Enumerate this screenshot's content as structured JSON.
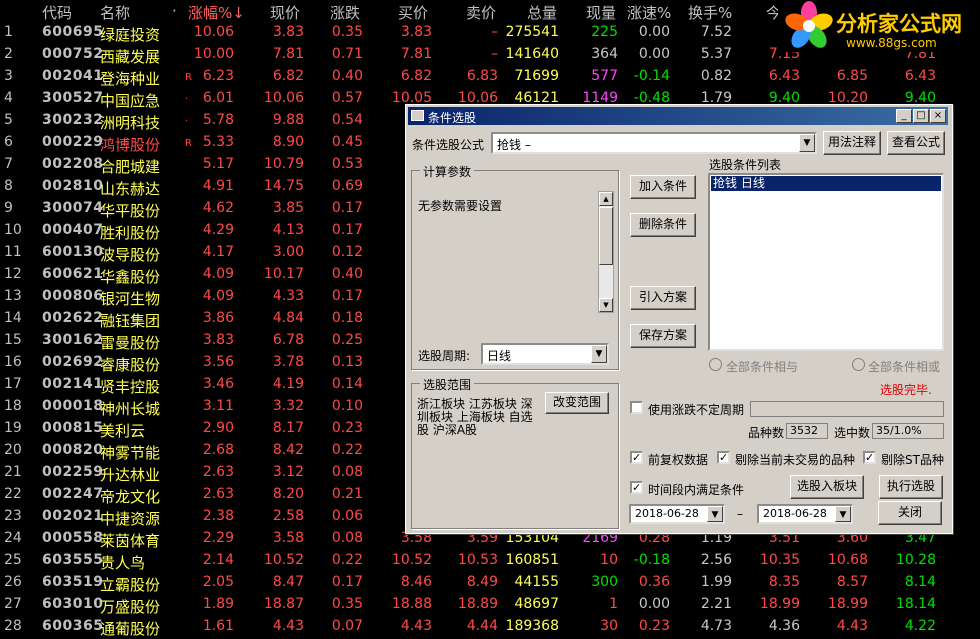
{
  "headers": [
    "代码",
    "名称",
    "·",
    "涨幅%↓",
    "现价",
    "涨跌",
    "买价",
    "卖价",
    "总量",
    "现量",
    "涨速%",
    "换手%",
    "今"
  ],
  "rows": [
    {
      "idx": "1",
      "code": "600695",
      "name": "绿庭投资",
      "flag": "",
      "pct": "10.06",
      "price": "3.83",
      "chg": "0.35",
      "bid": "3.83",
      "ask": "–",
      "vol": "275541",
      "cur": "225",
      "spd": "0.00",
      "turn": "7.52",
      "open": "3",
      "high": "",
      "low": "",
      "c4": ""
    },
    {
      "idx": "2",
      "code": "000752",
      "name": "西藏发展",
      "flag": "",
      "pct": "10.00",
      "price": "7.81",
      "chg": "0.71",
      "bid": "7.81",
      "ask": "–",
      "vol": "141640",
      "cur": "364",
      "spd": "0.00",
      "turn": "5.37",
      "open": "7.15",
      "high": "",
      "low": "",
      "c4": "7.81"
    },
    {
      "idx": "3",
      "code": "002041",
      "name": "登海种业",
      "flag": "R",
      "pct": "6.23",
      "price": "6.82",
      "chg": "0.40",
      "bid": "6.82",
      "ask": "6.83",
      "vol": "71699",
      "cur": "577",
      "spd": "-0.14",
      "turn": "0.82",
      "open": "6.43",
      "high": "6.85",
      "low": "",
      "c4": "6.43"
    },
    {
      "idx": "4",
      "code": "300527",
      "name": "中国应急",
      "flag": "·",
      "pct": "6.01",
      "price": "10.06",
      "chg": "0.57",
      "bid": "10.05",
      "ask": "10.06",
      "vol": "46121",
      "cur": "1149",
      "spd": "-0.48",
      "turn": "1.79",
      "open": "9.40",
      "high": "10.20",
      "low": "",
      "c4": "9.40"
    },
    {
      "idx": "5",
      "code": "300232",
      "name": "洲明科技",
      "flag": "·",
      "pct": "5.78",
      "price": "9.88",
      "chg": "0.54",
      "bid": "",
      "ask": "",
      "vol": "",
      "cur": "",
      "spd": "",
      "turn": "",
      "open": "",
      "high": "",
      "low": "",
      "c4": ""
    },
    {
      "idx": "6",
      "code": "000229",
      "name": "鸿博股份",
      "flag": "R",
      "pct": "5.33",
      "price": "8.90",
      "chg": "0.45",
      "bid": "",
      "ask": "",
      "vol": "",
      "cur": "",
      "spd": "",
      "turn": "",
      "open": "",
      "high": "",
      "low": "",
      "c4": ""
    },
    {
      "idx": "7",
      "code": "002208",
      "name": "合肥城建",
      "flag": "",
      "pct": "5.17",
      "price": "10.79",
      "chg": "0.53",
      "bid": "",
      "ask": "",
      "vol": "",
      "cur": "",
      "spd": "",
      "turn": "",
      "open": "",
      "high": "",
      "low": "",
      "c4": ""
    },
    {
      "idx": "8",
      "code": "002810",
      "name": "山东赫达",
      "flag": "",
      "pct": "4.91",
      "price": "14.75",
      "chg": "0.69",
      "bid": "",
      "ask": "",
      "vol": "",
      "cur": "",
      "spd": "",
      "turn": "",
      "open": "",
      "high": "",
      "low": "",
      "c4": ""
    },
    {
      "idx": "9",
      "code": "300074",
      "name": "华平股份",
      "flag": "",
      "pct": "4.62",
      "price": "3.85",
      "chg": "0.17",
      "bid": "",
      "ask": "",
      "vol": "",
      "cur": "",
      "spd": "",
      "turn": "",
      "open": "",
      "high": "",
      "low": "",
      "c4": ""
    },
    {
      "idx": "10",
      "code": "000407",
      "name": "胜利股份",
      "flag": "",
      "pct": "4.29",
      "price": "4.13",
      "chg": "0.17",
      "bid": "",
      "ask": "",
      "vol": "",
      "cur": "",
      "spd": "",
      "turn": "",
      "open": "",
      "high": "",
      "low": "",
      "c4": ""
    },
    {
      "idx": "11",
      "code": "600130",
      "name": "波导股份",
      "flag": "",
      "pct": "4.17",
      "price": "3.00",
      "chg": "0.12",
      "bid": "",
      "ask": "",
      "vol": "",
      "cur": "",
      "spd": "",
      "turn": "",
      "open": "",
      "high": "",
      "low": "",
      "c4": ""
    },
    {
      "idx": "12",
      "code": "600621",
      "name": "华鑫股份",
      "flag": "",
      "pct": "4.09",
      "price": "10.17",
      "chg": "0.40",
      "bid": "",
      "ask": "",
      "vol": "",
      "cur": "",
      "spd": "",
      "turn": "",
      "open": "",
      "high": "",
      "low": "",
      "c4": ""
    },
    {
      "idx": "13",
      "code": "000806",
      "name": "银河生物",
      "flag": "",
      "pct": "4.09",
      "price": "4.33",
      "chg": "0.17",
      "bid": "",
      "ask": "",
      "vol": "",
      "cur": "",
      "spd": "",
      "turn": "",
      "open": "",
      "high": "",
      "low": "",
      "c4": ""
    },
    {
      "idx": "14",
      "code": "002622",
      "name": "融钰集团",
      "flag": "",
      "pct": "3.86",
      "price": "4.84",
      "chg": "0.18",
      "bid": "",
      "ask": "",
      "vol": "",
      "cur": "",
      "spd": "",
      "turn": "",
      "open": "",
      "high": "",
      "low": "",
      "c4": ""
    },
    {
      "idx": "15",
      "code": "300162",
      "name": "雷曼股份",
      "flag": "",
      "pct": "3.83",
      "price": "6.78",
      "chg": "0.25",
      "bid": "",
      "ask": "",
      "vol": "",
      "cur": "",
      "spd": "",
      "turn": "",
      "open": "",
      "high": "",
      "low": "",
      "c4": ""
    },
    {
      "idx": "16",
      "code": "002692",
      "name": "睿康股份",
      "flag": "",
      "pct": "3.56",
      "price": "3.78",
      "chg": "0.13",
      "bid": "",
      "ask": "",
      "vol": "",
      "cur": "",
      "spd": "",
      "turn": "",
      "open": "",
      "high": "",
      "low": "",
      "c4": ""
    },
    {
      "idx": "17",
      "code": "002141",
      "name": "贤丰控股",
      "flag": "",
      "pct": "3.46",
      "price": "4.19",
      "chg": "0.14",
      "bid": "",
      "ask": "",
      "vol": "",
      "cur": "",
      "spd": "",
      "turn": "",
      "open": "",
      "high": "",
      "low": "",
      "c4": ""
    },
    {
      "idx": "18",
      "code": "000018",
      "name": "神州长城",
      "flag": "",
      "pct": "3.11",
      "price": "3.32",
      "chg": "0.10",
      "bid": "",
      "ask": "",
      "vol": "",
      "cur": "",
      "spd": "",
      "turn": "",
      "open": "",
      "high": "",
      "low": "",
      "c4": ""
    },
    {
      "idx": "19",
      "code": "000815",
      "name": "美利云",
      "flag": "",
      "pct": "2.90",
      "price": "8.17",
      "chg": "0.23",
      "bid": "",
      "ask": "",
      "vol": "",
      "cur": "",
      "spd": "",
      "turn": "",
      "open": "",
      "high": "",
      "low": "",
      "c4": ""
    },
    {
      "idx": "20",
      "code": "000820",
      "name": "神雾节能",
      "flag": "",
      "pct": "2.68",
      "price": "8.42",
      "chg": "0.22",
      "bid": "",
      "ask": "",
      "vol": "",
      "cur": "",
      "spd": "",
      "turn": "",
      "open": "",
      "high": "",
      "low": "",
      "c4": ""
    },
    {
      "idx": "21",
      "code": "002259",
      "name": "升达林业",
      "flag": "",
      "pct": "2.63",
      "price": "3.12",
      "chg": "0.08",
      "bid": "",
      "ask": "",
      "vol": "",
      "cur": "",
      "spd": "",
      "turn": "",
      "open": "",
      "high": "",
      "low": "",
      "c4": ""
    },
    {
      "idx": "22",
      "code": "002247",
      "name": "帝龙文化",
      "flag": "",
      "pct": "2.63",
      "price": "8.20",
      "chg": "0.21",
      "bid": "",
      "ask": "",
      "vol": "",
      "cur": "",
      "spd": "",
      "turn": "",
      "open": "",
      "high": "",
      "low": "",
      "c4": ""
    },
    {
      "idx": "23",
      "code": "002021",
      "name": "中捷资源",
      "flag": "",
      "pct": "2.38",
      "price": "2.58",
      "chg": "0.06",
      "bid": "",
      "ask": "",
      "vol": "",
      "cur": "",
      "spd": "",
      "turn": "",
      "open": "",
      "high": "",
      "low": "",
      "c4": ""
    },
    {
      "idx": "24",
      "code": "000558",
      "name": "莱茵体育",
      "flag": "",
      "pct": "2.29",
      "price": "3.58",
      "chg": "0.08",
      "bid": "3.58",
      "ask": "3.59",
      "vol": "153104",
      "cur": "2169",
      "spd": "0.28",
      "turn": "1.19",
      "open": "3.51",
      "high": "3.60",
      "low": "",
      "c4": "3.47"
    },
    {
      "idx": "25",
      "code": "603555",
      "name": "贵人鸟",
      "flag": "",
      "pct": "2.14",
      "price": "10.52",
      "chg": "0.22",
      "bid": "10.52",
      "ask": "10.53",
      "vol": "160851",
      "cur": "10",
      "spd": "-0.18",
      "turn": "2.56",
      "open": "10.35",
      "high": "10.68",
      "low": "",
      "c4": "10.28"
    },
    {
      "idx": "26",
      "code": "603519",
      "name": "立霸股份",
      "flag": "",
      "pct": "2.05",
      "price": "8.47",
      "chg": "0.17",
      "bid": "8.46",
      "ask": "8.49",
      "vol": "44155",
      "cur": "300",
      "spd": "0.36",
      "turn": "1.99",
      "open": "8.35",
      "high": "8.57",
      "low": "",
      "c4": "8.14"
    },
    {
      "idx": "27",
      "code": "603010",
      "name": "万盛股份",
      "flag": "",
      "pct": "1.89",
      "price": "18.87",
      "chg": "0.35",
      "bid": "18.88",
      "ask": "18.89",
      "vol": "48697",
      "cur": "1",
      "spd": "0.00",
      "turn": "2.21",
      "open": "18.99",
      "high": "18.99",
      "low": "",
      "c4": "18.14"
    },
    {
      "idx": "28",
      "code": "600365",
      "name": "通葡股份",
      "flag": "",
      "pct": "1.61",
      "price": "4.43",
      "chg": "0.07",
      "bid": "4.43",
      "ask": "4.44",
      "vol": "189368",
      "cur": "30",
      "spd": "0.23",
      "turn": "4.73",
      "open": "4.36",
      "high": "4.43",
      "low": "",
      "c4": "4.22"
    }
  ],
  "row_colors": {
    "name": [
      "yel",
      "yel",
      "yel",
      "yel",
      "yel",
      "red",
      "yel",
      "yel",
      "yel",
      "yel",
      "yel",
      "yel",
      "yel",
      "yel",
      "yel",
      "yel",
      "yel",
      "yel",
      "yel",
      "yel",
      "yel",
      "yel",
      "yel",
      "yel",
      "yel",
      "yel",
      "yel",
      "yel"
    ],
    "cur": [
      "grn",
      "wht",
      "mag",
      "mag",
      "",
      "",
      "",
      "",
      "",
      "",
      "",
      "",
      "",
      "",
      "",
      "",
      "",
      "",
      "",
      "",
      "",
      "",
      "",
      "mag",
      "red",
      "grn",
      "red",
      "red"
    ],
    "spd": [
      "wht",
      "wht",
      "grn",
      "grn",
      "",
      "",
      "",
      "",
      "",
      "",
      "",
      "",
      "",
      "",
      "",
      "",
      "",
      "",
      "",
      "",
      "",
      "",
      "",
      "red",
      "grn",
      "red",
      "wht",
      "red"
    ],
    "open": [
      "red",
      "red",
      "red",
      "grn",
      "",
      "",
      "",
      "",
      "",
      "",
      "",
      "",
      "",
      "",
      "",
      "",
      "",
      "",
      "",
      "",
      "",
      "",
      "",
      "red",
      "red",
      "red",
      "red",
      "wht"
    ],
    "high": [
      "",
      "",
      "red",
      "red",
      "",
      "",
      "",
      "",
      "",
      "",
      "",
      "",
      "",
      "",
      "",
      "",
      "",
      "",
      "",
      "",
      "",
      "",
      "",
      "red",
      "red",
      "red",
      "red",
      "red"
    ],
    "c4": [
      "",
      "red",
      "red",
      "grn",
      "",
      "",
      "",
      "",
      "",
      "",
      "",
      "",
      "",
      "",
      "",
      "",
      "",
      "",
      "",
      "",
      "",
      "",
      "",
      "grn",
      "grn",
      "grn",
      "grn",
      "grn"
    ]
  },
  "logo": {
    "title": "分析家公式网",
    "url": "www.88gs.com"
  },
  "dialog": {
    "title": "条件选股",
    "formula_label": "条件选股公式",
    "formula_value": "抢钱          –",
    "help_btn": "用法注释",
    "view_btn": "查看公式",
    "calc_group": "计算参数",
    "no_params": "无参数需要设置",
    "period_label": "选股周期:",
    "period_value": "日线",
    "add_btn": "加入条件",
    "del_btn": "删除条件",
    "import_btn": "引入方案",
    "save_btn": "保存方案",
    "cond_list_label": "选股条件列表",
    "cond_items": [
      "抢钱   日线"
    ],
    "radio_and": "全部条件相与",
    "radio_or": "全部条件相或",
    "status": "选股完毕.",
    "range_group": "选股范围",
    "range_text": "浙江板块 江苏板块 深圳板块 上海板块 自选股 沪深A股",
    "change_range_btn": "改变范围",
    "uncertain_label": "使用涨跌不定周期",
    "count_label": "品种数",
    "count_value": "3532",
    "selected_label": "选中数",
    "selected_value": "35/1.0%",
    "chk_fq": "前复权数据",
    "chk_notrade": "剔除当前未交易的品种",
    "chk_st": "剔除ST品种",
    "chk_range": "时间段内满足条件",
    "to_block_btn": "选股入板块",
    "run_btn": "执行选股",
    "date_from": "2018-06-28",
    "date_sep": "–",
    "date_to": "2018-06-28",
    "close_btn": "关闭"
  }
}
